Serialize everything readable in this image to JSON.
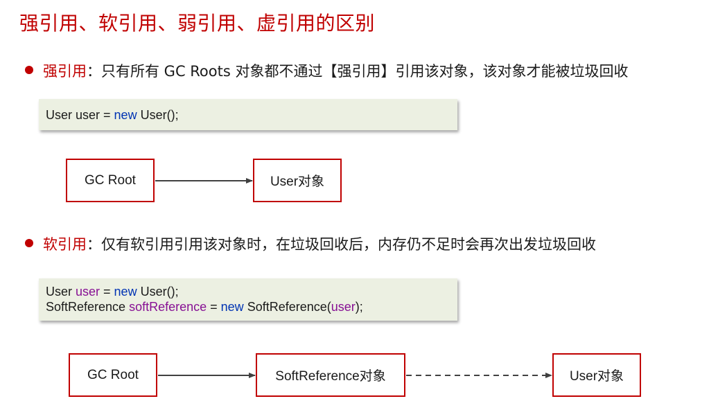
{
  "title": "强引用、软引用、弱引用、虚引用的区别",
  "strong": {
    "label": "强引用",
    "description": "：只有所有 GC Roots 对象都不通过【强引用】引用该对象，该对象才能被垃圾回收",
    "code": {
      "line1": {
        "type": "User user = ",
        "kw": "new",
        "rest": " User();"
      }
    },
    "diagram": {
      "root": "GC Root",
      "target": "User对象"
    }
  },
  "soft": {
    "label": "软引用",
    "description": "：仅有软引用引用该对象时，在垃圾回收后，内存仍不足时会再次出发垃圾回收",
    "code": {
      "line1": {
        "type": "User ",
        "var": "user",
        "eq": " = ",
        "kw": "new",
        "rest": " User();"
      },
      "line2": {
        "type": "SoftReference ",
        "var": "softReference",
        "eq": " = ",
        "kw": "new",
        "rest": " SoftReference(",
        "arg": "user",
        "end": ");"
      }
    },
    "diagram": {
      "root": "GC Root",
      "middle": "SoftReference对象",
      "target": "User对象"
    }
  }
}
